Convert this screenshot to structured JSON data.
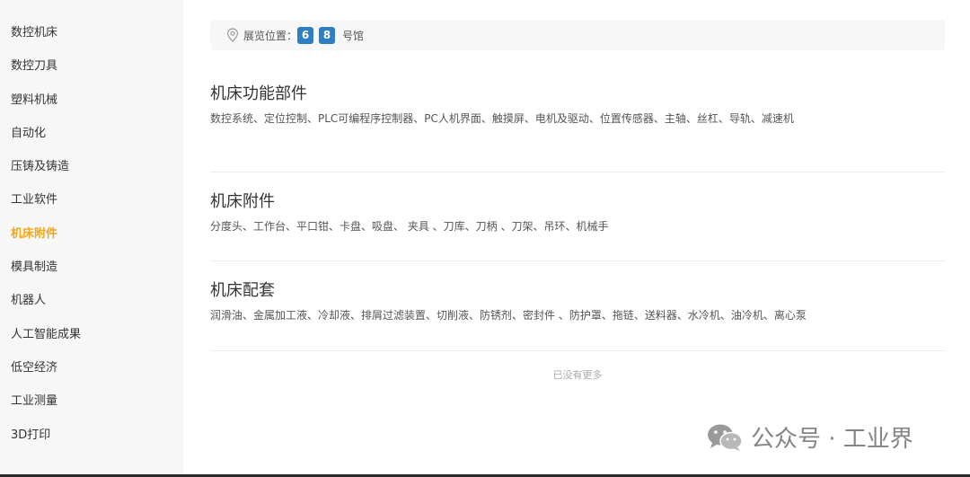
{
  "sidebar": {
    "items": [
      {
        "label": "数控机床",
        "active": false
      },
      {
        "label": "数控刀具",
        "active": false
      },
      {
        "label": "塑料机械",
        "active": false
      },
      {
        "label": "自动化",
        "active": false
      },
      {
        "label": "压铸及铸造",
        "active": false
      },
      {
        "label": "工业软件",
        "active": false
      },
      {
        "label": "机床附件",
        "active": true
      },
      {
        "label": "模具制造",
        "active": false
      },
      {
        "label": "机器人",
        "active": false
      },
      {
        "label": "人工智能成果",
        "active": false
      },
      {
        "label": "低空经济",
        "active": false
      },
      {
        "label": "工业测量",
        "active": false
      },
      {
        "label": "3D打印",
        "active": false
      }
    ],
    "active_color": "#f0a81e"
  },
  "location": {
    "label": "展览位置：",
    "halls": [
      "6",
      "8"
    ],
    "suffix": "号馆",
    "badge_color": "#2d7ec4",
    "icon": "location-pin-icon"
  },
  "sections": [
    {
      "title": "机床功能部件",
      "items": "数控系统、定位控制、PLC可编程序控制器、PC人机界面、触摸屏、电机及驱动、位置传感器、主轴、丝杠、导轨、减速机"
    },
    {
      "title": "机床附件",
      "items": "分度头、工作台、平口钳、卡盘、吸盘、 夹具 、刀库、刀柄 、刀架、吊环、机械手"
    },
    {
      "title": "机床配套",
      "items": "润滑油、金属加工液、冷却液、排屑过滤装置、切削液、防锈剂、密封件 、防护罩、拖链、送料器、水冷机、油冷机、离心泵"
    }
  ],
  "footer": {
    "no_more": "已没有更多"
  },
  "watermark": {
    "text": "公众号 · 工业界",
    "icon": "wechat-icon"
  }
}
